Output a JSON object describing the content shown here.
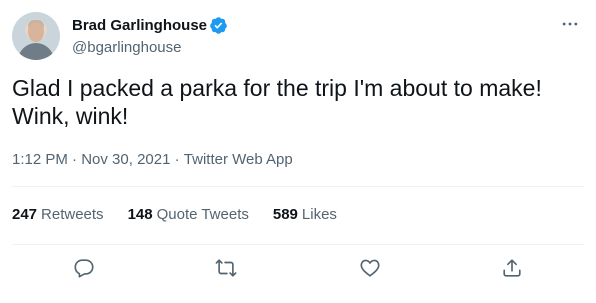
{
  "author": {
    "display_name": "Brad Garlinghouse",
    "handle": "@bgarlinghouse",
    "verified": true
  },
  "tweet": {
    "text": "Glad I packed a parka for the trip I'm about to make!\nWink, wink!",
    "time": "1:12 PM",
    "date": "Nov 30, 2021",
    "source": "Twitter Web App",
    "separator": " · "
  },
  "stats": {
    "retweets": {
      "count": "247",
      "label": "Retweets"
    },
    "quote_tweets": {
      "count": "148",
      "label": "Quote Tweets"
    },
    "likes": {
      "count": "589",
      "label": "Likes"
    }
  },
  "icons": {
    "more": "more-horizontal-icon",
    "verified": "verified-badge-icon",
    "reply": "reply-icon",
    "retweet": "retweet-icon",
    "like": "heart-icon",
    "share": "share-icon"
  },
  "colors": {
    "text_primary": "#0f1419",
    "text_secondary": "#536471",
    "verified_blue": "#1d9bf0",
    "divider": "#eff3f4"
  }
}
